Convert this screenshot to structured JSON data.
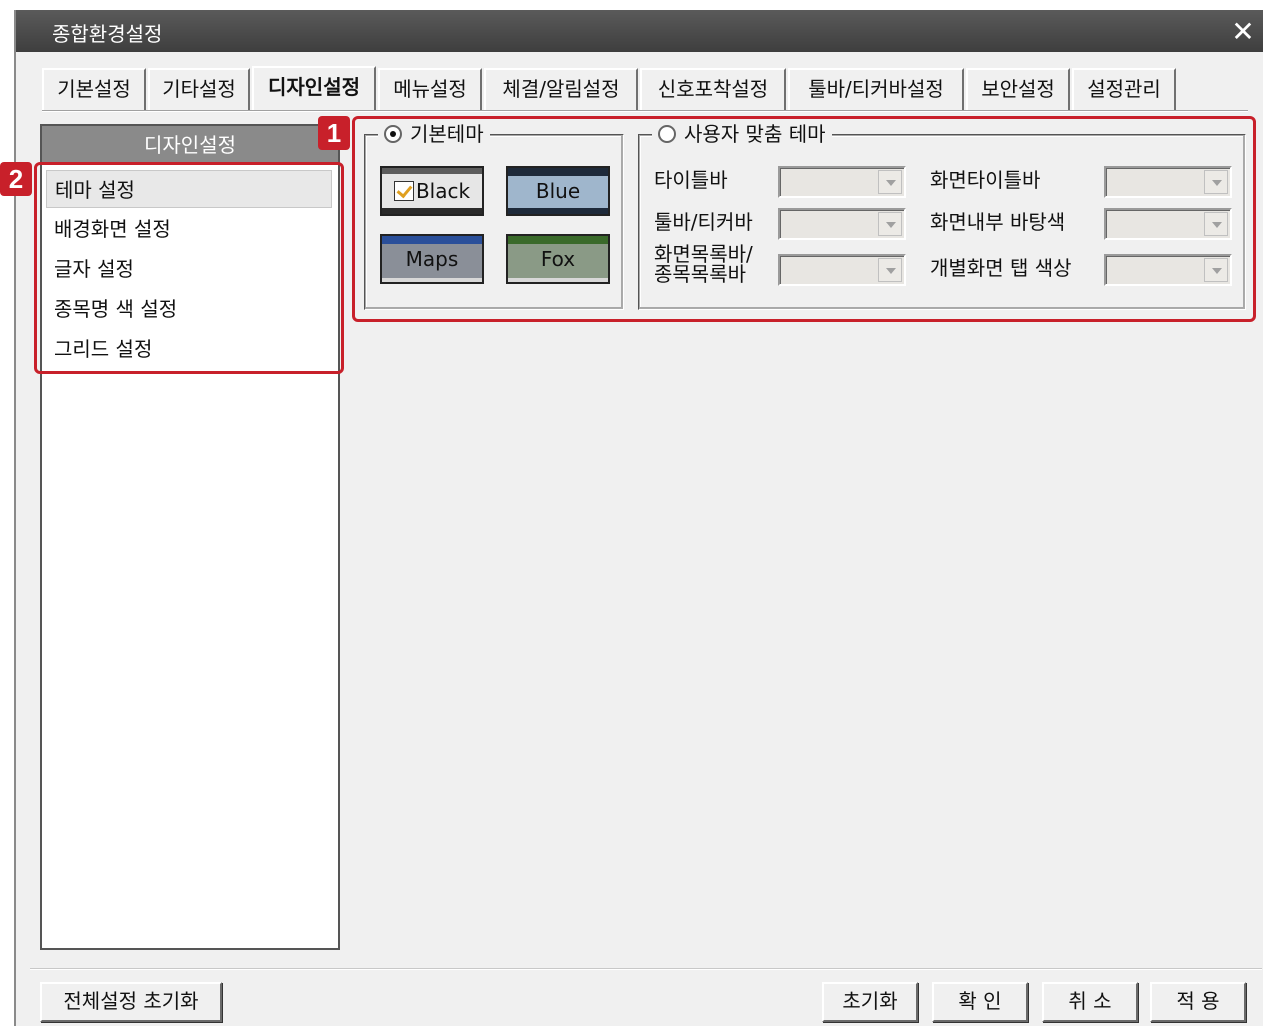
{
  "window": {
    "title": "종합환경설정",
    "close_label": "✕"
  },
  "tabs": [
    {
      "label": "기본설정"
    },
    {
      "label": "기타설정"
    },
    {
      "label": "디자인설정"
    },
    {
      "label": "메뉴설정"
    },
    {
      "label": "체결/알림설정"
    },
    {
      "label": "신호포착설정"
    },
    {
      "label": "툴바/티커바설정"
    },
    {
      "label": "보안설정"
    },
    {
      "label": "설정관리"
    }
  ],
  "active_tab_index": 2,
  "sidebar": {
    "header": "디자인설정",
    "items": [
      {
        "label": "테마 설정"
      },
      {
        "label": "배경화면 설정"
      },
      {
        "label": "글자 설정"
      },
      {
        "label": "종목명 색 설정"
      },
      {
        "label": "그리드 설정"
      }
    ],
    "selected_index": 0
  },
  "annotations": {
    "badge1": "1",
    "badge2": "2"
  },
  "basic_theme": {
    "legend": "기본테마",
    "selected": true,
    "themes": [
      {
        "label": "Black",
        "checked": true
      },
      {
        "label": "Blue"
      },
      {
        "label": "Maps"
      },
      {
        "label": "Fox"
      }
    ]
  },
  "custom_theme": {
    "legend": "사용자 맞춤 테마",
    "selected": false,
    "fields": [
      {
        "label": "타이틀바"
      },
      {
        "label": "툴바/티커바"
      },
      {
        "label_line1": "화면목록바/",
        "label_line2": "종목목록바"
      },
      {
        "label": "화면타이틀바"
      },
      {
        "label": "화면내부 바탕색"
      },
      {
        "label": "개별화면 탭 색상"
      }
    ]
  },
  "footer": {
    "reset_all": "전체설정 초기화",
    "reset": "초기화",
    "ok": "확 인",
    "cancel": "취 소",
    "apply": "적 용"
  }
}
